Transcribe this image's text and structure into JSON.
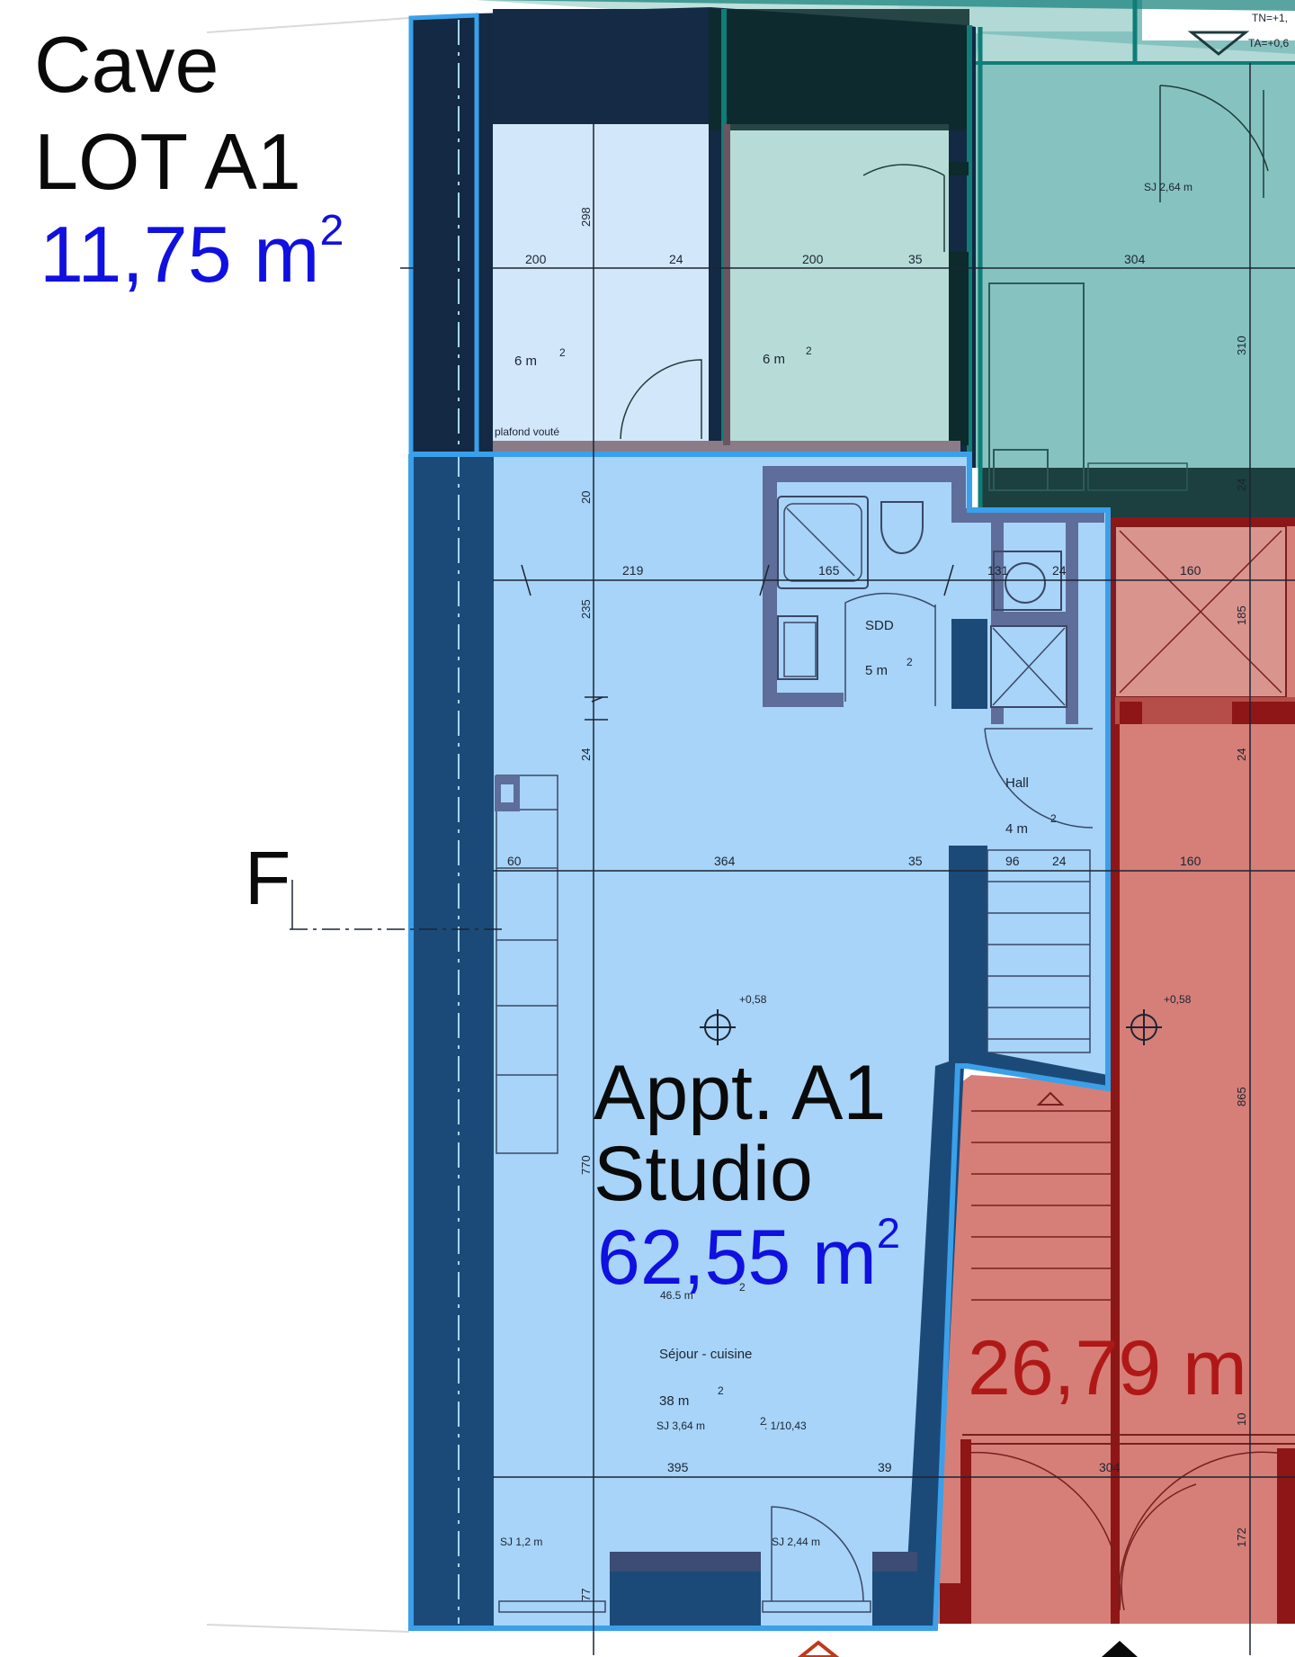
{
  "cave": {
    "title": "Cave",
    "lot": "LOT A1",
    "area_value": "11,75 m",
    "area_exp": "2"
  },
  "section_marker": "F",
  "appartment": {
    "name": "Appt. A1",
    "type": "Studio",
    "area_value": "62,55 m",
    "area_exp": "2"
  },
  "neighbour_area": "26,79 m",
  "rooms": {
    "cellar_left_area": "6 m",
    "cellar_right_area": "6 m",
    "sdd_label": "SDD",
    "sdd_area": "5 m",
    "hall_label": "Hall",
    "hall_area": "4 m",
    "sejour_area": "46.5 m",
    "sejour_label": "Séjour - cuisine",
    "sejour_sub_area": "38 m",
    "sejour_note": "SJ 3,64 m",
    "sejour_ratio": ": 1/10,43",
    "sj_top": "SJ 2,64 m",
    "sj_left": "SJ 1,2 m",
    "sj_bottom": "SJ 2,44 m",
    "plafond": "plafond vouté",
    "level_left": "+0,58",
    "level_right": "+0,58",
    "tn": "TN=+1,",
    "ta": "TA=+0,6"
  },
  "dimensions": {
    "top_row": [
      "200",
      "24",
      "200",
      "35",
      "304"
    ],
    "mid_row": [
      "219",
      "165",
      "131",
      "24",
      "160"
    ],
    "lower_row": [
      "60",
      "364",
      "35",
      "96",
      "24",
      "160"
    ],
    "bottom_row": [
      "395",
      "39",
      "304"
    ],
    "vertical": [
      "298",
      "310",
      "20",
      "235",
      "24",
      "185",
      "24",
      "770",
      "865",
      "77",
      "10",
      "172",
      "24"
    ]
  },
  "palette": {
    "dark_wall": "#173050",
    "cave_fill": "#d3e7fa",
    "teal_fill": "#86c3c0",
    "teal_light": "#b7dcd7",
    "studio_fill": "#a7d4f8",
    "studio_outline": "#3aa0ea",
    "red_fill": "#d57f78",
    "red_dark": "#8e1616"
  }
}
